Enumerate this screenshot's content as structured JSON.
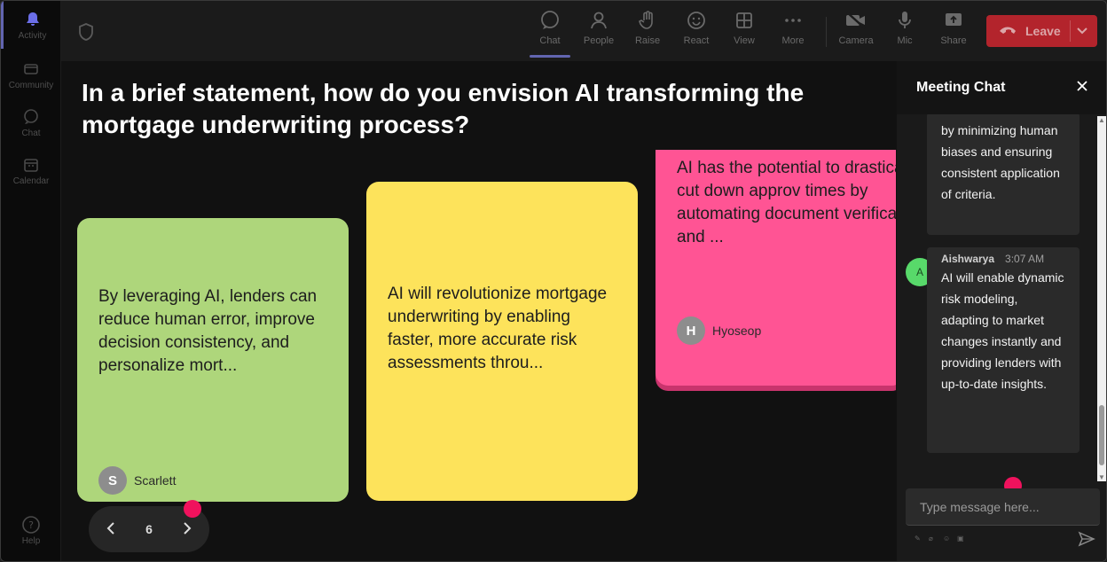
{
  "rail": {
    "items": [
      {
        "label": "Activity",
        "icon": "bell-icon",
        "active": true
      },
      {
        "label": "Community",
        "icon": "community-icon"
      },
      {
        "label": "Chat",
        "icon": "chat-icon"
      },
      {
        "label": "Calendar",
        "icon": "calendar-icon"
      }
    ],
    "help": {
      "label": "Help",
      "icon": "help-icon"
    }
  },
  "toolbar": {
    "buttons": [
      {
        "label": "Chat",
        "icon": "chat-icon",
        "active": true
      },
      {
        "label": "People",
        "icon": "people-icon"
      },
      {
        "label": "Raise",
        "icon": "raise-hand-icon"
      },
      {
        "label": "React",
        "icon": "react-icon"
      },
      {
        "label": "View",
        "icon": "view-icon"
      },
      {
        "label": "More",
        "icon": "more-icon"
      },
      {
        "label": "Camera",
        "icon": "camera-off-icon"
      },
      {
        "label": "Mic",
        "icon": "mic-icon"
      },
      {
        "label": "Share",
        "icon": "share-icon"
      }
    ],
    "leave_label": "Leave",
    "leave_color": "#c4262e"
  },
  "stage": {
    "question": "In a brief statement, how do you envision AI transforming the mortgage underwriting process?",
    "cards": [
      {
        "text": "By leveraging AI, lenders can reduce human error, improve decision consistency, and personalize mort...",
        "author": "Scarlett",
        "initial": "S",
        "color": "#aed67b"
      },
      {
        "text": "AI will revolutionize mortgage underwriting by enabling faster, more accurate risk assessments throu...",
        "author": "",
        "initial": "",
        "color": "#fde35b"
      },
      {
        "text": "AI has the potential to drastically cut down approv times by automating document verification and ...",
        "author": "Hyoseop",
        "initial": "H",
        "color": "#ff5494"
      }
    ],
    "page_number": "6"
  },
  "chat": {
    "title": "Meeting Chat",
    "messages": [
      {
        "text": "by minimizing human biases and ensuring consistent application of criteria."
      },
      {
        "sender": "Aishwarya",
        "initial": "A",
        "time": "3:07 AM",
        "text": "AI will enable dynamic risk modeling, adapting to market changes instantly and providing lenders with up-to-date insights."
      }
    ],
    "input_placeholder": "Type message here..."
  }
}
